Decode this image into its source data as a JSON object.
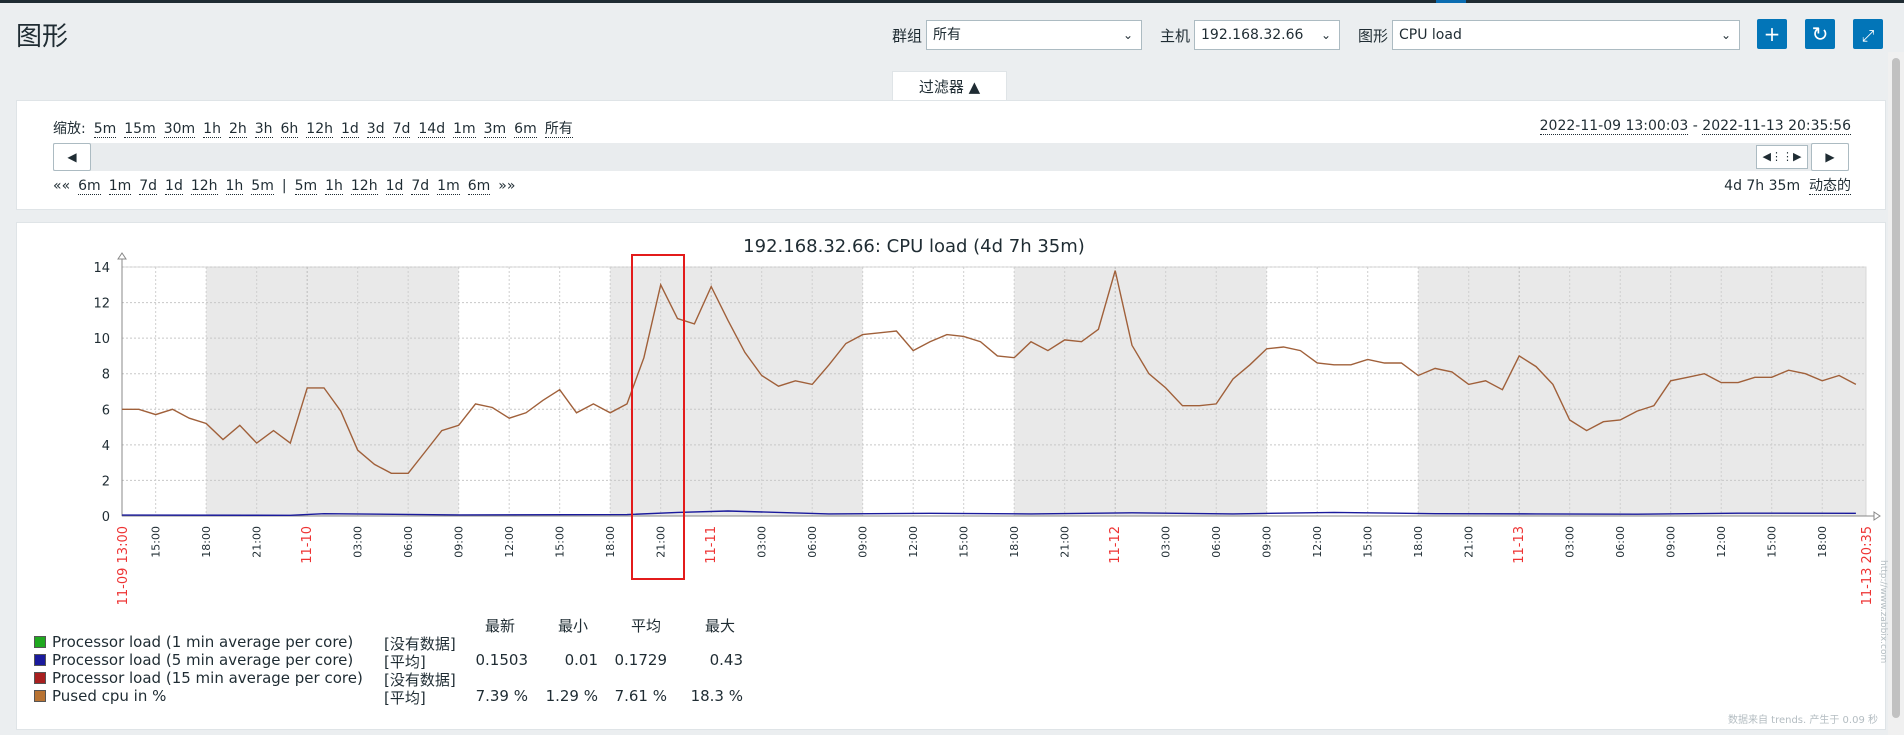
{
  "page": {
    "title": "图形"
  },
  "header": {
    "group_label": "群组",
    "group_value": "所有",
    "host_label": "主机",
    "host_value": "192.168.32.66",
    "graph_label": "图形",
    "graph_value": "CPU load",
    "add_icon": "plus-icon",
    "refresh_icon": "refresh-icon",
    "fullscreen_icon": "fullscreen-icon",
    "accent": "#0275b8"
  },
  "filter": {
    "tab_label": "过滤器 ▲",
    "zoom_label": "缩放:",
    "zoom_items": [
      "5m",
      "15m",
      "30m",
      "1h",
      "2h",
      "3h",
      "6h",
      "12h",
      "1d",
      "3d",
      "7d",
      "14d",
      "1m",
      "3m",
      "6m",
      "所有"
    ],
    "range_from": "2022-11-09 13:00:03",
    "range_sep": " - ",
    "range_to": "2022-11-13 20:35:56",
    "nav_back_prefix": "««",
    "nav_back_items": [
      "6m",
      "1m",
      "7d",
      "1d",
      "12h",
      "1h",
      "5m"
    ],
    "nav_sep": "|",
    "nav_fwd_items": [
      "5m",
      "1h",
      "12h",
      "1d",
      "7d",
      "1m",
      "6m"
    ],
    "nav_fwd_suffix": "»»",
    "duration": "4d 7h 35m",
    "dynamic_label": "动态的"
  },
  "chart_data": {
    "type": "line",
    "title": "192.168.32.66: CPU load (4d 7h 35m)",
    "ylim": [
      0,
      14
    ],
    "y_ticks": [
      0,
      2,
      4,
      6,
      8,
      10,
      12,
      14
    ],
    "x_start_label": "11-09 13:00",
    "x_end_label": "11-13 20:35",
    "x_ticks": [
      "15:00",
      "18:00",
      "21:00",
      "11-10",
      "03:00",
      "06:00",
      "09:00",
      "12:00",
      "15:00",
      "18:00",
      "21:00",
      "11-11",
      "03:00",
      "06:00",
      "09:00",
      "12:00",
      "15:00",
      "18:00",
      "21:00",
      "11-12",
      "03:00",
      "06:00",
      "09:00",
      "12:00",
      "15:00",
      "18:00",
      "21:00",
      "11-13",
      "03:00",
      "06:00",
      "09:00",
      "12:00",
      "15:00",
      "18:00"
    ],
    "grid": true,
    "series": [
      {
        "name": "Pused cpu in %",
        "color": "#a0603a",
        "x_hours": [
          0,
          1,
          2,
          3,
          4,
          5,
          6,
          7,
          8,
          9,
          10,
          11,
          12,
          13,
          14,
          15,
          16,
          17,
          18,
          19,
          20,
          21,
          22,
          23,
          24,
          25,
          26,
          27,
          28,
          29,
          30,
          31,
          32,
          33,
          34,
          35,
          36,
          37,
          38,
          39,
          40,
          41,
          42,
          43,
          44,
          45,
          46,
          47,
          48,
          49,
          50,
          51,
          52,
          53,
          54,
          55,
          56,
          57,
          58,
          59,
          60,
          61,
          62,
          63,
          64,
          65,
          66,
          67,
          68,
          69,
          70,
          71,
          72,
          73,
          74,
          75,
          76,
          77,
          78,
          79,
          80,
          81,
          82,
          83,
          84,
          85,
          86,
          87,
          88,
          89,
          90,
          91,
          92,
          93,
          94,
          95,
          96,
          97,
          98,
          99,
          100,
          101,
          102,
          103
        ],
        "values": [
          6.0,
          6.0,
          5.7,
          6.0,
          5.5,
          5.2,
          4.3,
          5.1,
          4.1,
          4.8,
          4.1,
          7.2,
          7.2,
          5.9,
          3.7,
          2.9,
          2.4,
          2.4,
          3.6,
          4.8,
          5.1,
          6.3,
          6.1,
          5.5,
          5.8,
          6.5,
          7.1,
          5.8,
          6.3,
          5.8,
          6.3,
          8.9,
          13.0,
          11.1,
          10.8,
          12.9,
          11.0,
          9.2,
          7.9,
          7.3,
          7.6,
          7.4,
          8.5,
          9.7,
          10.2,
          10.3,
          10.4,
          9.3,
          9.8,
          10.2,
          10.1,
          9.8,
          9.0,
          8.9,
          9.8,
          9.3,
          9.9,
          9.8,
          10.5,
          13.8,
          9.6,
          8.0,
          7.2,
          6.2,
          6.2,
          6.3,
          7.7,
          8.5,
          9.4,
          9.5,
          9.3,
          8.6,
          8.5,
          8.5,
          8.8,
          8.6,
          8.6,
          7.9,
          8.3,
          8.1,
          7.4,
          7.6,
          7.1,
          9.0,
          8.4,
          7.4,
          5.4,
          4.8,
          5.3,
          5.4,
          5.9,
          6.2,
          7.6,
          7.8,
          8.0,
          7.5,
          7.5,
          7.8,
          7.8,
          8.2,
          8.0,
          7.6,
          7.9,
          7.4
        ]
      },
      {
        "name": "Processor load (5 min average per core)",
        "color": "#1a1a9c",
        "x_hours": [
          0,
          10,
          12,
          20,
          30,
          33,
          36,
          42,
          48,
          54,
          60,
          66,
          72,
          78,
          84,
          90,
          96,
          103
        ],
        "values": [
          0.05,
          0.04,
          0.13,
          0.06,
          0.08,
          0.2,
          0.28,
          0.12,
          0.15,
          0.12,
          0.18,
          0.12,
          0.2,
          0.13,
          0.12,
          0.1,
          0.16,
          0.15
        ]
      }
    ],
    "legend": {
      "columns": [
        "最新",
        "最小",
        "平均",
        "最大"
      ],
      "rows": [
        {
          "color": "#1fa81f",
          "name": "Processor load (1 min average per core)",
          "func": "[没有数据]",
          "last": "",
          "min": "",
          "avg": "",
          "max": ""
        },
        {
          "color": "#1a1a9c",
          "name": "Processor load (5 min average per core)",
          "func": "[平均]",
          "last": "0.1503",
          "min": "0.01",
          "avg": "0.1729",
          "max": "0.43"
        },
        {
          "color": "#a81f1f",
          "name": "Processor load (15 min average per core)",
          "func": "[没有数据]",
          "last": "",
          "min": "",
          "avg": "",
          "max": ""
        },
        {
          "color": "#b87333",
          "name": "Pused cpu in %",
          "func": "[平均]",
          "last": "7.39 %",
          "min": "1.29 %",
          "avg": "7.61 %",
          "max": "18.3 %"
        }
      ]
    }
  },
  "footer": {
    "generated": "数据来自 trends. 产生于 0.09 秒",
    "watermark": "http://www.zabbix.com"
  }
}
